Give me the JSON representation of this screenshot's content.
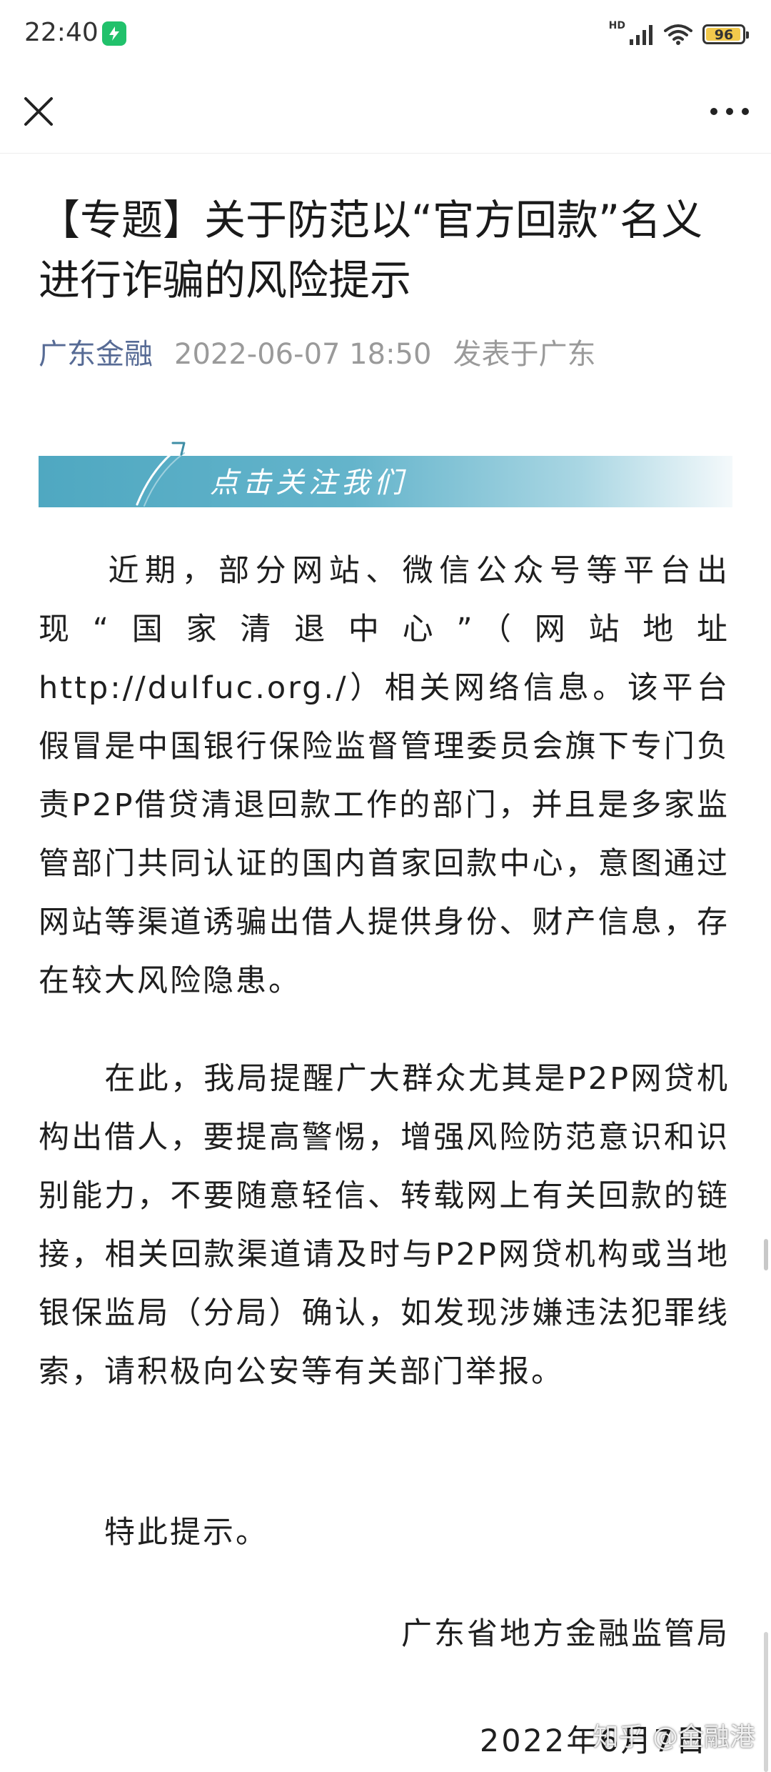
{
  "status_bar": {
    "time": "22:40",
    "network_label": "HD",
    "battery_level": 96,
    "battery_text": "96"
  },
  "nav": {
    "close_icon": "close-icon",
    "more_icon": "more-icon"
  },
  "article": {
    "title": "【专题】关于防范以“官方回款”名义进行诈骗的风险提示",
    "source": "广东金融",
    "date": "2022-06-07 18:50",
    "location": "发表于广东",
    "follow_banner_text": "点击关注我们",
    "paragraphs": [
      "近期，部分网站、微信公众号等平台出现“国家清退中心”（网站地址http://dulfuc.org./）相关网络信息。该平台假冒是中国银行保险监督管理委员会旗下专门负责P2P借贷清退回款工作的部门，并且是多家监管部门共同认证的国内首家回款中心，意图通过网站等渠道诱骗出借人提供身份、财产信息，存在较大风险隐患。",
      "在此，我局提醒广大群众尤其是P2P网贷机构出借人，要提高警惕，增强风险防范意识和识别能力，不要随意轻信、转载网上有关回款的链接，相关回款渠道请及时与P2P网贷机构或当地银保监局（分局）确认，如发现涉嫌违法犯罪线索，请积极向公安等有关部门举报。",
      "特此提示。"
    ],
    "signature": "广东省地方金融监管局",
    "signature_date": "2022年6月7日"
  },
  "watermark": "知乎 @金融港",
  "colors": {
    "source_link": "#576b95",
    "meta_gray": "#9a9a9a",
    "banner_start": "#4fa8c1",
    "app_icon_green": "#21c16b",
    "battery_fill": "#f2c94c"
  }
}
